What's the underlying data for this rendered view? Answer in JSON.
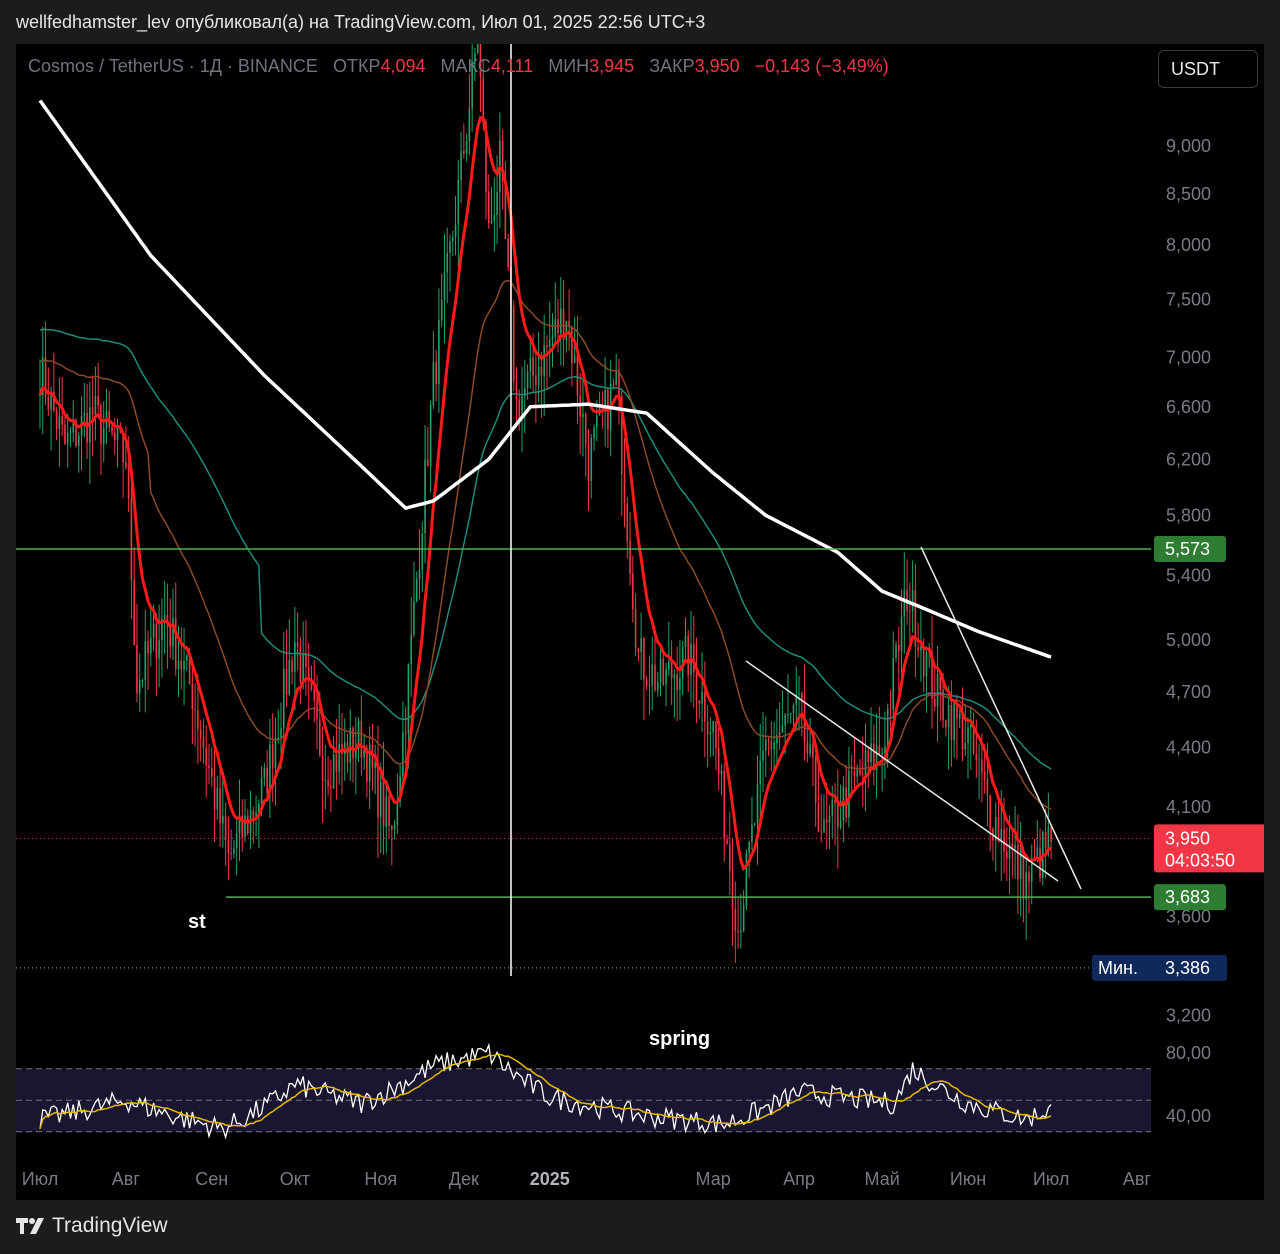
{
  "header": {
    "text": "wellfedhamster_lev опубликовал(а) на TradingView.com, Июл 01, 2025 22:56 UTC+3"
  },
  "legend": {
    "symbol": "Cosmos / TetherUS · 1Д · BINANCE",
    "open_label": "ОТКР",
    "open": "4,094",
    "high_label": "МАКС",
    "high": "4,111",
    "low_label": "МИН",
    "low": "3,945",
    "close_label": "ЗАКР",
    "close": "3,950",
    "change": "−0,143 (−3,49%)"
  },
  "currency_button": "USDT",
  "footer": {
    "brand": "TradingView"
  },
  "colors": {
    "background": "#000000",
    "up": "#26a269",
    "down": "#f23645",
    "ema_red": "#ff1a1a",
    "ma_white": "#ffffff",
    "ma_teal": "#1e8a7a",
    "ma_brown": "#8a4a25",
    "level_green": "#4caf50",
    "rsi_yellow": "#e6b800"
  },
  "chart_data": {
    "type": "candlestick",
    "y_scale": "log",
    "ylim": [
      3.05,
      10.4
    ],
    "y_ticks": [
      "9,000",
      "8,500",
      "8,000",
      "7,500",
      "7,000",
      "6,600",
      "6,200",
      "5,800",
      "5,400",
      "5,000",
      "4,700",
      "4,400",
      "4,100",
      "3,600",
      "3,200"
    ],
    "x_ticks": [
      "Июл",
      "Авг",
      "Сен",
      "Окт",
      "Ноя",
      "Дек",
      "2025",
      "Мар",
      "Апр",
      "Май",
      "Июн",
      "Июл",
      "Авг"
    ],
    "x_ticks_bold": [
      "2025"
    ],
    "levels": [
      {
        "name": "resistance",
        "value": 5.573,
        "label": "5,573"
      },
      {
        "name": "support",
        "value": 3.683,
        "label": "3,683"
      }
    ],
    "last_price": {
      "value": 3.95,
      "label": "3,950",
      "countdown": "04:03:50"
    },
    "min_marker": {
      "label": "Мин.",
      "value": 3.386,
      "value_label": "3,386"
    },
    "annotations": [
      "st",
      "spring"
    ],
    "price_anchors": [
      {
        "date": "2024-07-01",
        "close": 6.9
      },
      {
        "date": "2024-07-10",
        "close": 6.3
      },
      {
        "date": "2024-07-20",
        "close": 6.55
      },
      {
        "date": "2024-08-01",
        "close": 6.2
      },
      {
        "date": "2024-08-05",
        "close": 4.75
      },
      {
        "date": "2024-08-15",
        "close": 5.15
      },
      {
        "date": "2024-08-25",
        "close": 4.7
      },
      {
        "date": "2024-09-07",
        "close": 3.85
      },
      {
        "date": "2024-09-20",
        "close": 4.2
      },
      {
        "date": "2024-10-01",
        "close": 5.0
      },
      {
        "date": "2024-10-12",
        "close": 4.3
      },
      {
        "date": "2024-10-25",
        "close": 4.45
      },
      {
        "date": "2024-11-05",
        "close": 3.95
      },
      {
        "date": "2024-11-10",
        "close": 4.6
      },
      {
        "date": "2024-11-20",
        "close": 6.8
      },
      {
        "date": "2024-12-02",
        "close": 9.2
      },
      {
        "date": "2024-12-06",
        "close": 10.3
      },
      {
        "date": "2024-12-10",
        "close": 8.1
      },
      {
        "date": "2024-12-14",
        "close": 8.8
      },
      {
        "date": "2024-12-20",
        "close": 6.6
      },
      {
        "date": "2025-01-07",
        "close": 7.4
      },
      {
        "date": "2025-01-15",
        "close": 6.2
      },
      {
        "date": "2025-01-25",
        "close": 6.8
      },
      {
        "date": "2025-02-02",
        "close": 4.9
      },
      {
        "date": "2025-02-10",
        "close": 4.75
      },
      {
        "date": "2025-02-20",
        "close": 4.9
      },
      {
        "date": "2025-03-01",
        "close": 4.5
      },
      {
        "date": "2025-03-10",
        "close": 3.55
      },
      {
        "date": "2025-03-20",
        "close": 4.4
      },
      {
        "date": "2025-04-01",
        "close": 4.6
      },
      {
        "date": "2025-04-10",
        "close": 3.95
      },
      {
        "date": "2025-04-20",
        "close": 4.2
      },
      {
        "date": "2025-05-01",
        "close": 4.4
      },
      {
        "date": "2025-05-10",
        "close": 5.3
      },
      {
        "date": "2025-05-20",
        "close": 4.7
      },
      {
        "date": "2025-06-01",
        "close": 4.45
      },
      {
        "date": "2025-06-10",
        "close": 4.05
      },
      {
        "date": "2025-06-22",
        "close": 3.75
      },
      {
        "date": "2025-07-01",
        "close": 3.95
      }
    ],
    "ma200_anchors": [
      {
        "date": "2024-07-01",
        "value": 9.5
      },
      {
        "date": "2024-08-10",
        "value": 7.9
      },
      {
        "date": "2024-09-20",
        "value": 6.85
      },
      {
        "date": "2024-10-25",
        "value": 6.15
      },
      {
        "date": "2024-11-10",
        "value": 5.85
      },
      {
        "date": "2024-11-20",
        "value": 5.9
      },
      {
        "date": "2024-12-10",
        "value": 6.2
      },
      {
        "date": "2024-12-25",
        "value": 6.6
      },
      {
        "date": "2025-01-15",
        "value": 6.62
      },
      {
        "date": "2025-02-05",
        "value": 6.55
      },
      {
        "date": "2025-03-01",
        "value": 6.1
      },
      {
        "date": "2025-03-20",
        "value": 5.8
      },
      {
        "date": "2025-04-15",
        "value": 5.55
      },
      {
        "date": "2025-05-01",
        "value": 5.3
      },
      {
        "date": "2025-05-15",
        "value": 5.2
      },
      {
        "date": "2025-06-05",
        "value": 5.05
      },
      {
        "date": "2025-07-01",
        "value": 4.9
      }
    ],
    "rsi": {
      "ticks": [
        "80,00",
        "40,00"
      ],
      "band": [
        30,
        70
      ],
      "anchors": [
        {
          "date": "2024-07-01",
          "value": 38
        },
        {
          "date": "2024-08-01",
          "value": 50
        },
        {
          "date": "2024-09-05",
          "value": 32
        },
        {
          "date": "2024-10-01",
          "value": 60
        },
        {
          "date": "2024-10-25",
          "value": 48
        },
        {
          "date": "2024-11-20",
          "value": 72
        },
        {
          "date": "2024-12-10",
          "value": 80
        },
        {
          "date": "2025-01-01",
          "value": 52
        },
        {
          "date": "2025-02-05",
          "value": 40
        },
        {
          "date": "2025-03-05",
          "value": 35
        },
        {
          "date": "2025-04-01",
          "value": 55
        },
        {
          "date": "2025-05-05",
          "value": 48
        },
        {
          "date": "2025-05-12",
          "value": 70
        },
        {
          "date": "2025-06-01",
          "value": 48
        },
        {
          "date": "2025-06-22",
          "value": 38
        },
        {
          "date": "2025-07-01",
          "value": 45
        }
      ]
    }
  }
}
